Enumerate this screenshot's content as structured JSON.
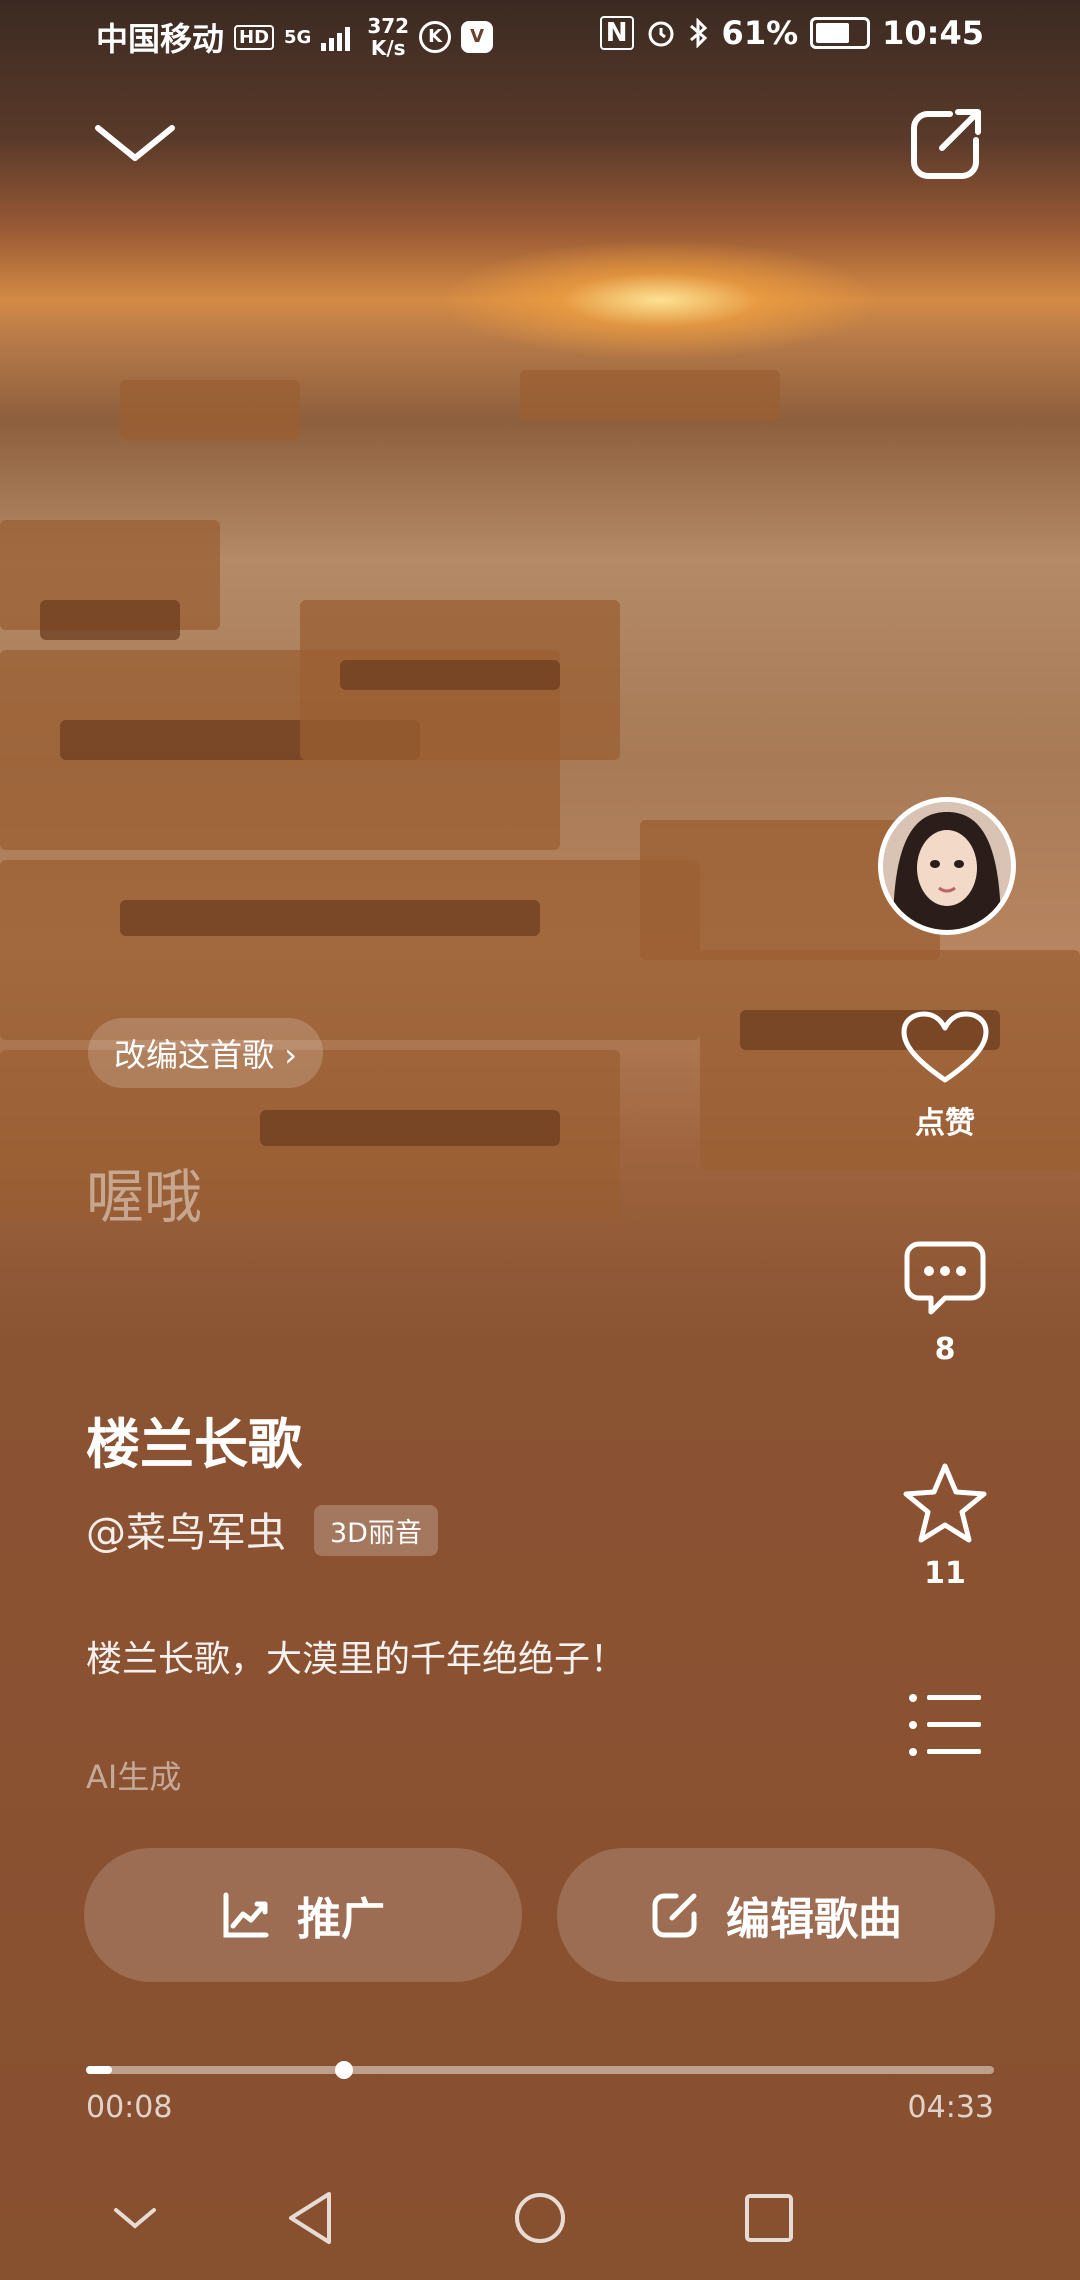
{
  "status_bar": {
    "carrier": "中国移动",
    "hd": "HD",
    "network": "5G",
    "speed_value": "372",
    "speed_unit": "K/s",
    "battery_percent": "61%",
    "time": "10:45"
  },
  "overlay": {
    "adapt_song_label": "改编这首歌",
    "lyric_line": "喔哦"
  },
  "actions": {
    "like_label": "点赞",
    "comment_count": "8",
    "favorite_count": "11"
  },
  "song": {
    "title": "楼兰长歌",
    "author": "@菜鸟军虫",
    "audio_tag": "3D丽音",
    "description": "楼兰长歌，大漠里的千年绝绝子！",
    "ai_label": "AI生成"
  },
  "buttons": {
    "promote_label": "推广",
    "edit_label": "编辑歌曲"
  },
  "playback": {
    "current_time": "00:08",
    "total_time": "04:33",
    "progress_fraction": 0.029
  },
  "colors": {
    "background": "#8a5230",
    "accent": "#ffffff"
  }
}
